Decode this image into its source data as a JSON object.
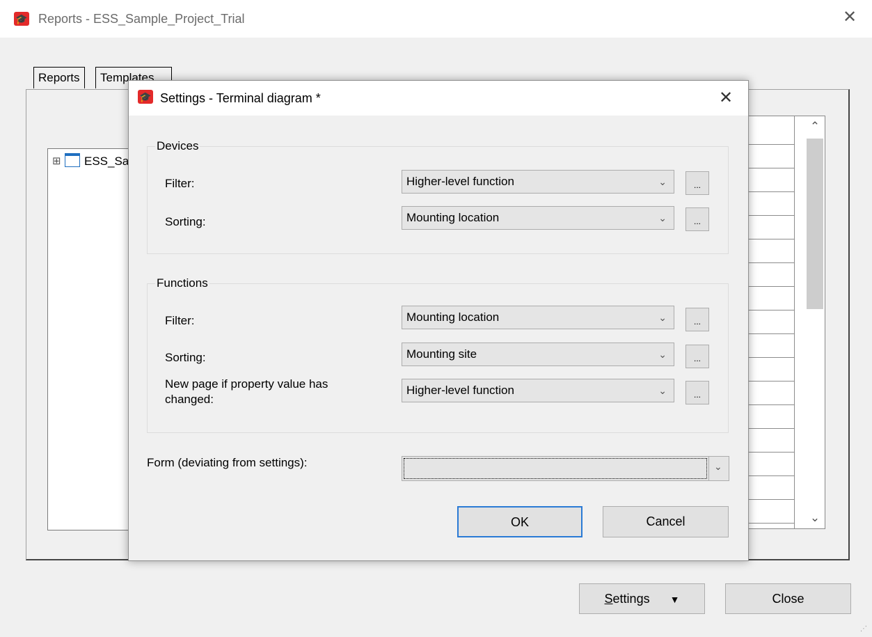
{
  "window": {
    "title": "Reports - ESS_Sample_Project_Trial",
    "close_glyph": "✕"
  },
  "tabs": [
    {
      "label": "Reports"
    },
    {
      "label": "Templates"
    }
  ],
  "tree": {
    "root_label": "ESS_Sample_Project_Trial",
    "expand_glyph": "⊞"
  },
  "grid_scroll": {
    "up": "⌃",
    "down": "⌄"
  },
  "footer": {
    "settings_label": "Settings",
    "settings_mnemonic": "S",
    "settings_rest": "ettings",
    "settings_arrow": "▼",
    "close_label": "Close"
  },
  "dialog": {
    "title": "Settings - Terminal diagram *",
    "close_glyph": "✕",
    "devices": {
      "legend": "Devices",
      "filter_label": "Filter:",
      "filter_value": "Higher-level function",
      "sorting_label": "Sorting:",
      "sorting_value": "Mounting location"
    },
    "functions": {
      "legend": "Functions",
      "filter_label": "Filter:",
      "filter_value": "Mounting location",
      "sorting_label": "Sorting:",
      "sorting_value": "Mounting site",
      "newpage_label": "New page if property value has changed:",
      "newpage_value": "Higher-level function"
    },
    "form_label": "Form (deviating from settings):",
    "form_value": "",
    "ellipsis": "...",
    "chevron": "⌄",
    "ok_label": "OK",
    "cancel_label": "Cancel"
  },
  "colors": {
    "brand": "#e32a2a",
    "ok_border": "#2a7ad5"
  }
}
